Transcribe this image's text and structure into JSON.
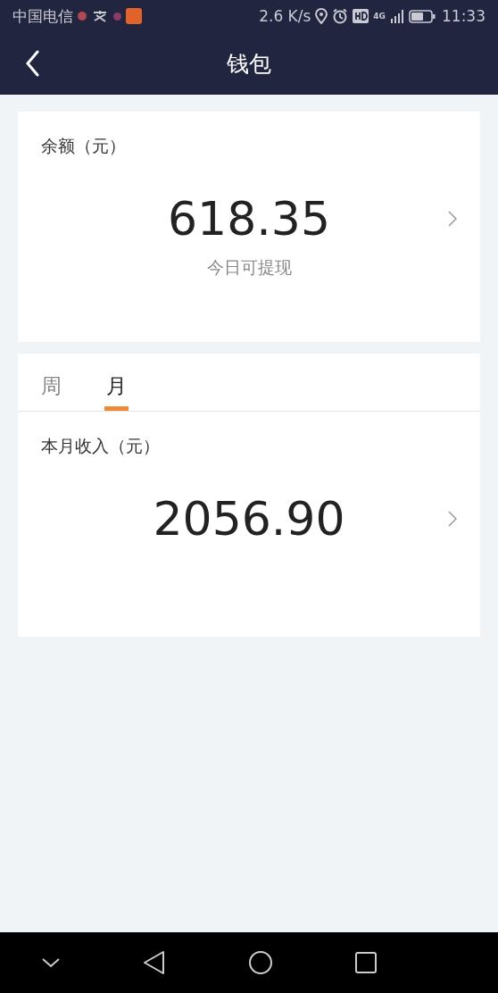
{
  "status_bar": {
    "carrier": "中国电信",
    "speed": "2.6 K/s",
    "network": "4G",
    "time": "11:33"
  },
  "nav": {
    "title": "钱包"
  },
  "balance": {
    "label": "余额（元）",
    "amount": "618.35",
    "note": "今日可提现"
  },
  "tabs": [
    {
      "label": "周",
      "selected": false
    },
    {
      "label": "月",
      "selected": true
    }
  ],
  "income": {
    "label": "本月收入（元）",
    "amount": "2056.90"
  }
}
